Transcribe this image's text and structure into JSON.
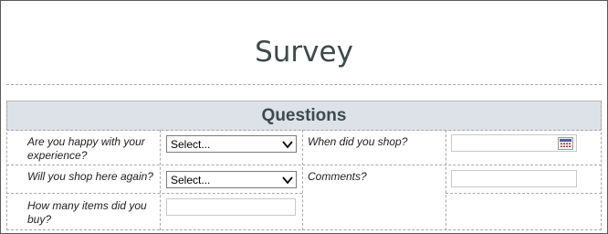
{
  "page": {
    "title": "Survey"
  },
  "section": {
    "title": "Questions"
  },
  "questions": {
    "happy": {
      "label": "Are you happy with your experience?",
      "selected": "Select..."
    },
    "shop_again": {
      "label": "Will you shop here again?",
      "selected": "Select..."
    },
    "items": {
      "label": "How many items did you buy?",
      "value": ""
    },
    "when": {
      "label": "When did you shop?",
      "value": ""
    },
    "comments": {
      "label": "Comments?",
      "value": ""
    }
  },
  "icons": {
    "dropdown": "chevron-down-icon",
    "date": "calendar-icon"
  },
  "colors": {
    "section_band": "#dde2e8",
    "title_text": "#3c4a4a"
  }
}
